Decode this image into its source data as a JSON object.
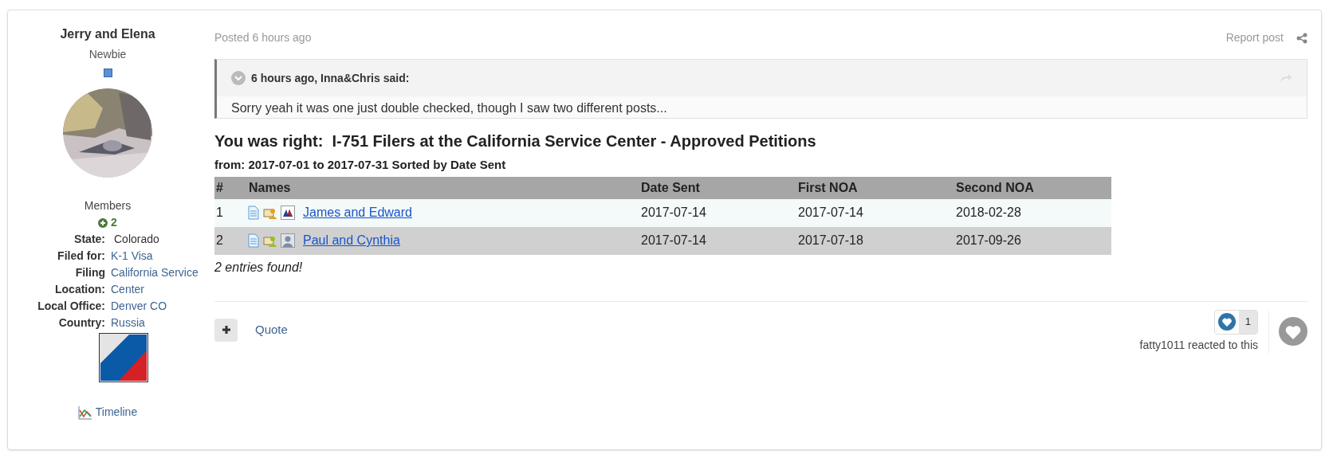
{
  "author": {
    "name": "Jerry and Elena",
    "rank": "Newbie",
    "group": "Members",
    "reputation": "2",
    "fields": [
      {
        "label": "State:",
        "value": "Colorado",
        "link": false
      },
      {
        "label": "Filed for:",
        "value": "K-1 Visa",
        "link": true
      },
      {
        "label": "Filing Location:",
        "value": "California Service Center",
        "link": true
      },
      {
        "label": "Local Office:",
        "value": "Denver CO",
        "link": true
      },
      {
        "label": "Country:",
        "value": "Russia",
        "link": true
      }
    ],
    "timeline": "Timeline"
  },
  "post": {
    "posted": "Posted 6 hours ago",
    "report": "Report post",
    "quote": {
      "header": "6 hours ago, Inna&Chris said:",
      "text": "Sorry yeah it was one just double checked, though I saw two different posts..."
    },
    "heading": "You was right:  I-751 Filers at the California Service Center - Approved Petitions",
    "subheading": "from: 2017-07-01 to 2017-07-31 Sorted by Date Sent",
    "table": {
      "columns": [
        "#",
        "Names",
        "Date Sent",
        "First NOA",
        "Second NOA"
      ],
      "rows": [
        {
          "num": "1",
          "name": "James and Edward",
          "date_sent": "2017-07-14",
          "first_noa": "2017-07-14",
          "second_noa": "2018-02-28",
          "kind": "flag"
        },
        {
          "num": "2",
          "name": "Paul and Cynthia",
          "date_sent": "2017-07-14",
          "first_noa": "2017-07-18",
          "second_noa": "2017-09-26",
          "kind": "person"
        }
      ]
    },
    "footer_note": "2 entries found!",
    "actions": {
      "quote": "Quote",
      "reaction_count": "1",
      "reacted": "fatty1011 reacted to this"
    }
  }
}
